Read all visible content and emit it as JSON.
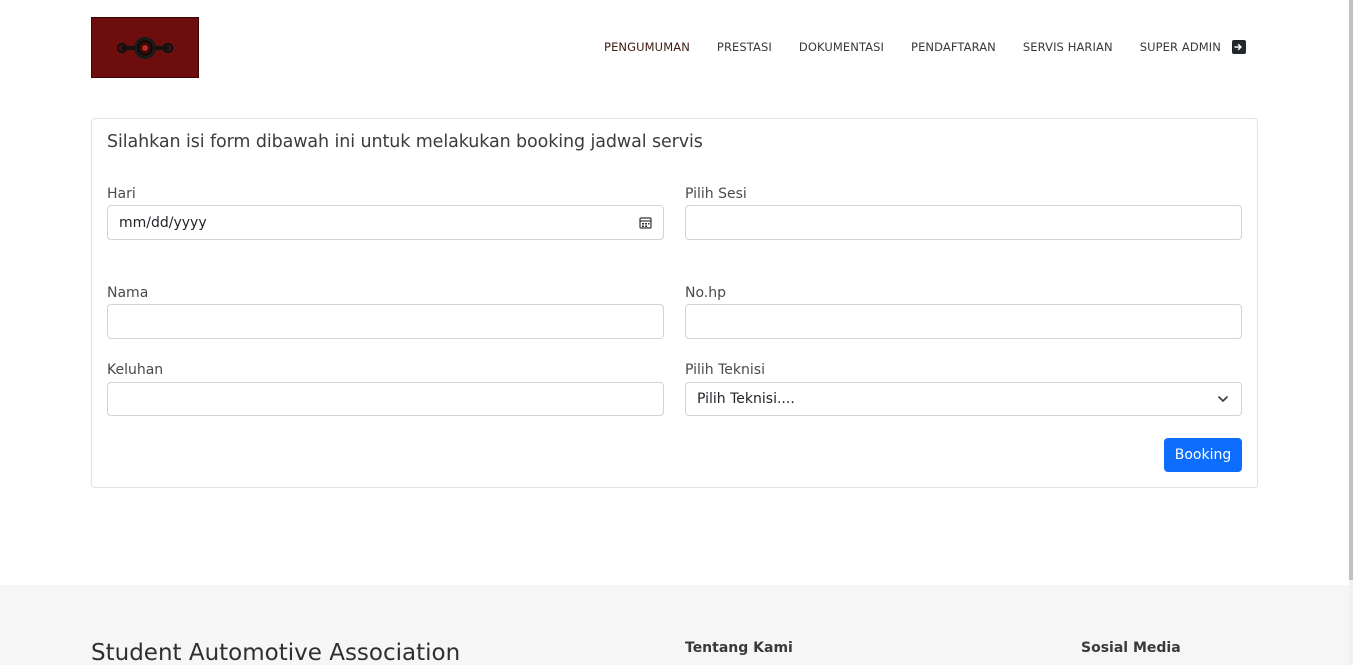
{
  "header": {
    "nav": [
      {
        "label": "PENGUMUMAN"
      },
      {
        "label": "PRESTASI"
      },
      {
        "label": "DOKUMENTASI"
      },
      {
        "label": "PENDAFTARAN"
      },
      {
        "label": "SERVIS HARIAN"
      },
      {
        "label": "SUPER ADMIN"
      }
    ],
    "login_icon": "login-arrow-icon"
  },
  "form": {
    "title": "Silahkan isi form dibawah ini untuk melakukan booking jadwal servis",
    "hari": {
      "label": "Hari",
      "value": "mm/dd/yyyy"
    },
    "sesi": {
      "label": "Pilih Sesi",
      "value": ""
    },
    "nama": {
      "label": "Nama",
      "value": ""
    },
    "nohp": {
      "label": "No.hp",
      "value": ""
    },
    "keluhan": {
      "label": "Keluhan",
      "value": ""
    },
    "teknisi": {
      "label": "Pilih Teknisi",
      "selected": "Pilih Teknisi...."
    },
    "submit_label": "Booking"
  },
  "footer": {
    "brand": "Student Automotive Association",
    "about_heading": "Tentang Kami",
    "social_heading": "Sosial Media"
  },
  "colors": {
    "logo_bg": "#6e0d0d",
    "primary_button": "#0d6efd",
    "footer_bg": "#f6f6f6"
  }
}
